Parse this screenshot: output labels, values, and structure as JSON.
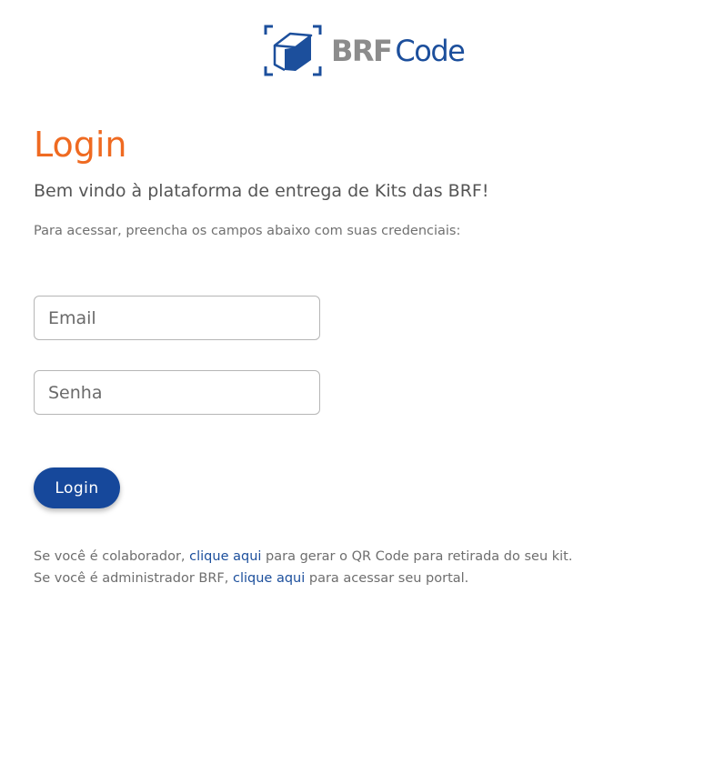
{
  "brand": {
    "logo_brf": "BRF",
    "logo_code": "Code",
    "icon": "box-scan-icon",
    "colors": {
      "blue": "#1c4f9c",
      "gray": "#8c8c8c",
      "orange": "#ef6a21",
      "button": "#16489b"
    }
  },
  "login": {
    "title": "Login",
    "welcome": "Bem vindo à plataforma de entrega de Kits das BRF!",
    "instructions": "Para acessar, preencha os campos abaixo com suas credenciais:",
    "email_placeholder": "Email",
    "password_placeholder": "Senha",
    "submit_label": "Login"
  },
  "footer": {
    "collaborator_prefix": "Se você é colaborador, ",
    "collaborator_link": "clique aqui",
    "collaborator_suffix": " para gerar o QR Code para retirada do seu kit.",
    "admin_prefix": "Se você é administrador BRF, ",
    "admin_link": "clique aqui",
    "admin_suffix": " para acessar seu portal."
  }
}
